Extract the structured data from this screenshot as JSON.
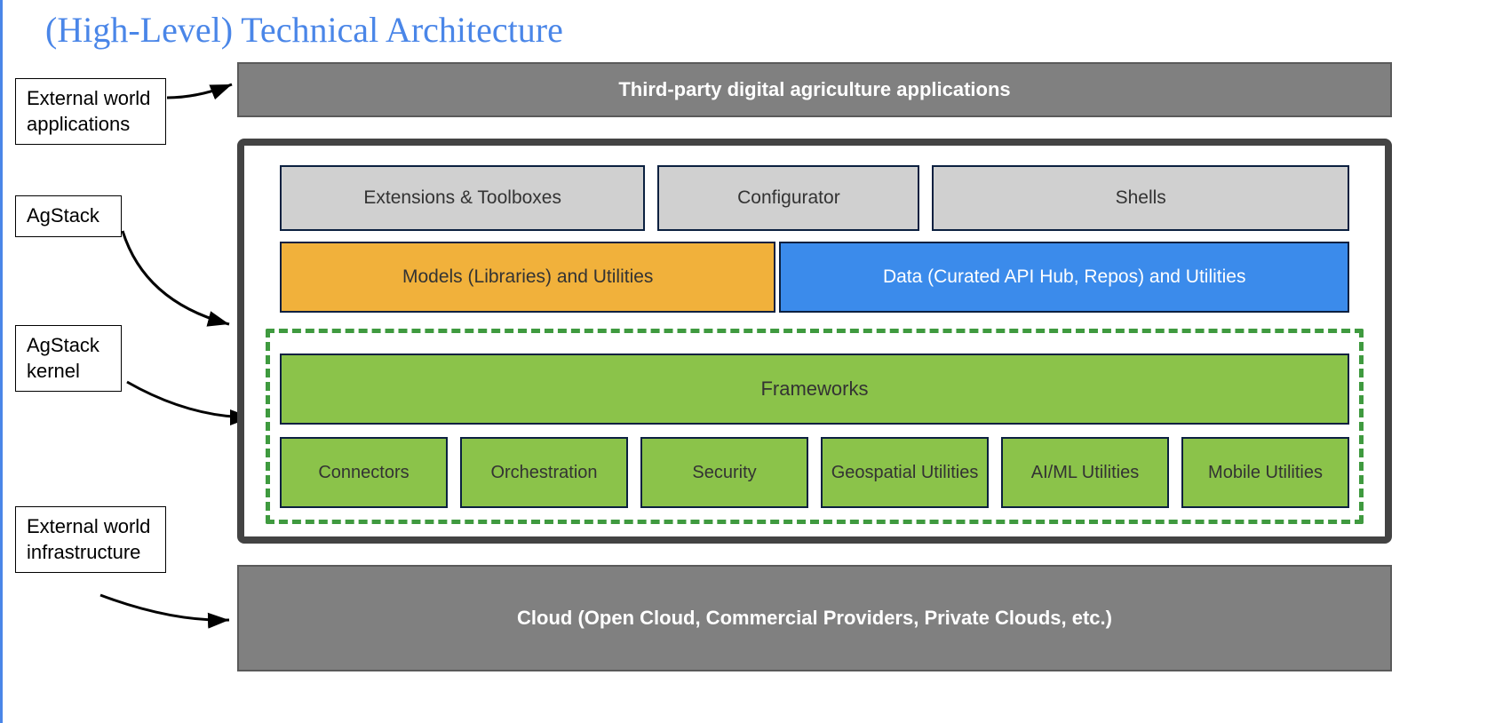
{
  "title": "(High-Level) Technical Architecture",
  "callouts": {
    "external_apps": "External world applications",
    "agstack": "AgStack",
    "agstack_kernel": "AgStack kernel",
    "external_infra": "External world infrastructure"
  },
  "top_bar": "Third-party digital agriculture applications",
  "tools": {
    "extensions": "Extensions & Toolboxes",
    "configurator": "Configurator",
    "shells": "Shells"
  },
  "mid": {
    "models": "Models (Libraries) and Utilities",
    "data": "Data (Curated API Hub, Repos) and Utilities"
  },
  "frameworks": "Frameworks",
  "utilities": [
    "Connectors",
    "Orchestration",
    "Security",
    "Geospatial Utilities",
    "AI/ML Utilities",
    "Mobile Utilities"
  ],
  "bottom_bar": "Cloud (Open Cloud, Commercial Providers, Private Clouds, etc.)"
}
